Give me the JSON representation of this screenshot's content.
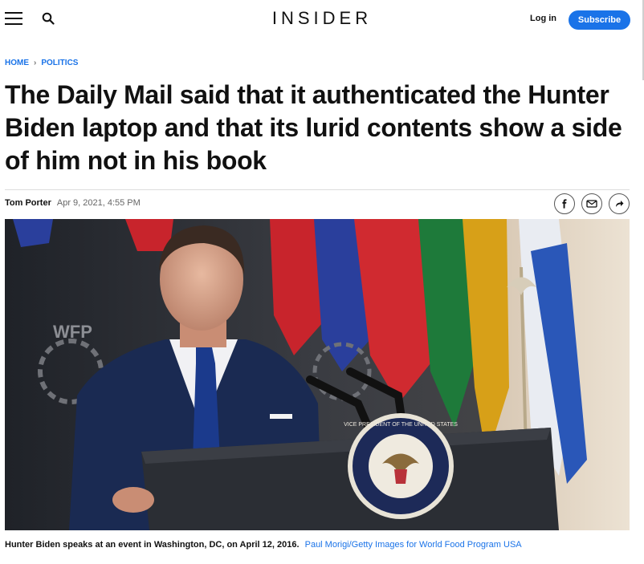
{
  "header": {
    "logo": "INSIDER",
    "login_label": "Log in",
    "subscribe_label": "Subscribe"
  },
  "breadcrumb": {
    "home": "HOME",
    "section": "POLITICS"
  },
  "article": {
    "headline": "The Daily Mail said that it authenticated the Hunter Biden laptop and that its lurid contents show a side of him not in his book",
    "author": "Tom Porter",
    "date": "Apr 9, 2021, 4:55 PM"
  },
  "share_icons": [
    "facebook-icon",
    "email-icon",
    "share-icon"
  ],
  "photo": {
    "wfp_text": "WFP",
    "seal_text": "VICE PRESIDENT OF THE UNITED STATES",
    "caption": "Hunter Biden speaks at an event in Washington, DC, on April 12, 2016.",
    "credit": "Paul Morigi/Getty Images for World Food Program USA"
  },
  "colors": {
    "accent": "#1a73e8",
    "text": "#111111"
  }
}
